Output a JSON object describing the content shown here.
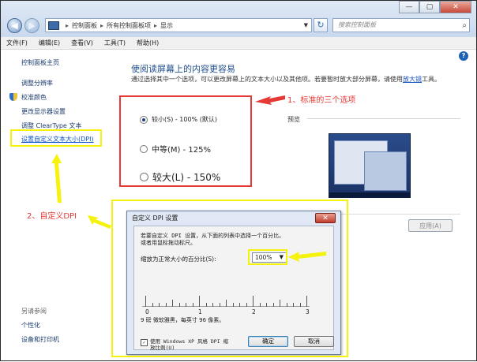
{
  "window": {
    "minimize_label": "—",
    "maximize_label": "▢",
    "close_label": "✕"
  },
  "nav": {
    "back_glyph": "◀",
    "forward_glyph": "▶",
    "breadcrumb": [
      "控制面板",
      "所有控制面板项",
      "显示"
    ],
    "refresh_glyph": "↻",
    "search_placeholder": "搜索控制面板",
    "search_icon": "search-icon"
  },
  "menu": [
    "文件(F)",
    "编辑(E)",
    "查看(V)",
    "工具(T)",
    "帮助(H)"
  ],
  "sidebar": {
    "items": [
      {
        "label": "控制面板主页"
      },
      {
        "label": "调整分辨率"
      },
      {
        "label": "校准颜色"
      },
      {
        "label": "更改显示器设置"
      },
      {
        "label": "调整 ClearType 文本"
      },
      {
        "label": "设置自定义文本大小(DPI)"
      }
    ],
    "see_also": "另请参阅",
    "see_also_items": [
      {
        "label": "个性化"
      },
      {
        "label": "设备和打印机"
      }
    ]
  },
  "main": {
    "help_glyph": "?",
    "title": "使阅读屏幕上的内容更容易",
    "description": "通过选择其中一个选项，可以更改屏幕上的文本大小以及其他项。若要暂时放大部分屏幕，请使用",
    "description_link": "放大镜",
    "description_tail": "工具。",
    "options": [
      {
        "label": "较小(S) - 100% (默认)",
        "selected": true
      },
      {
        "label": "中等(M) - 125%",
        "selected": false
      },
      {
        "label": "较大(L) - 150%",
        "selected": false
      }
    ],
    "preview_label": "预览",
    "apply_label": "应用(A)"
  },
  "dialog": {
    "title": "自定义 DPI 设置",
    "close_label": "✕",
    "instructions_line1": "若要自定义 DPI 设置，从下面的列表中选择一个百分比。",
    "instructions_line2": "或者用鼠标拖动标尺。",
    "scale_label": "缩放为正常大小的百分比(S):",
    "scale_value": "100%",
    "ruler_labels": [
      "0",
      "1",
      "2",
      "3"
    ],
    "sample_text": "9 磅 微软雅黑，每英寸 96 像素。",
    "checkbox_label_line1": "使用 Windows XP 风格 DPI 缩",
    "checkbox_label_line2": "放比例(U)",
    "checkbox_checked": true,
    "ok_label": "确定",
    "cancel_label": "取消"
  },
  "annotations": {
    "note1": "1、标准的三个选项",
    "note2": "2、自定义DPI",
    "red_color": "#e53935",
    "yellow_color": "#f5f20d"
  }
}
